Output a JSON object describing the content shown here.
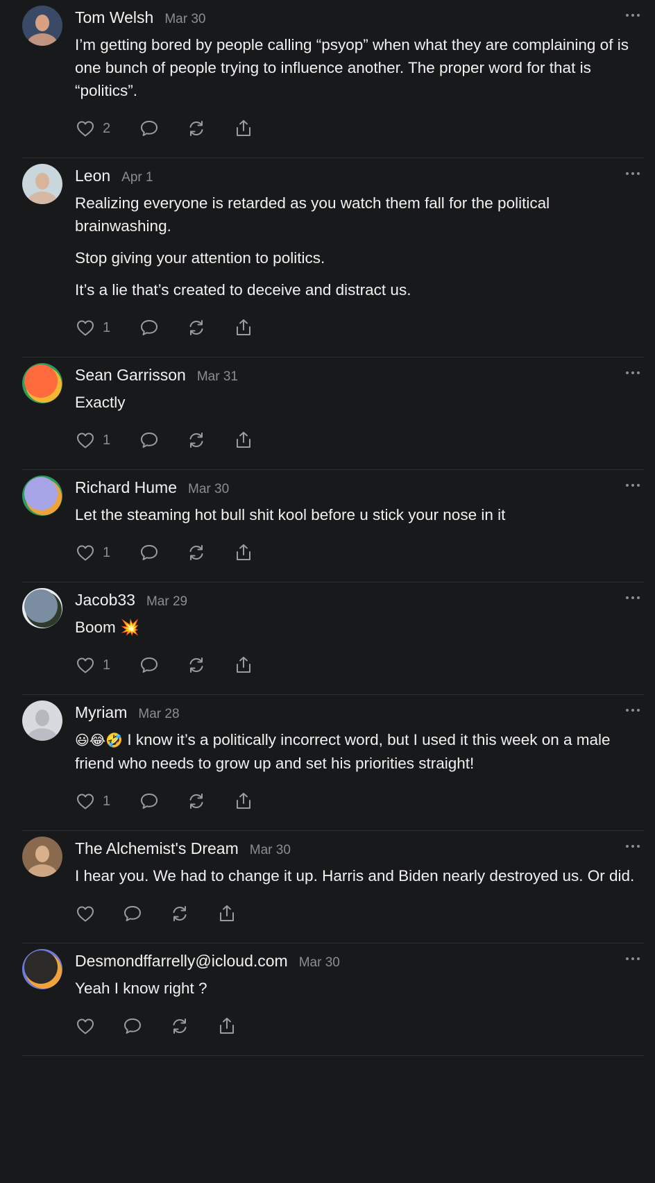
{
  "comments": [
    {
      "author": "Tom Welsh",
      "date": "Mar 30",
      "paragraphs": [
        "I’m getting bored by people calling “psyop” when what they are complaining of is one bunch of people trying to influence another. The proper word for that is “politics”."
      ],
      "likes": "2",
      "avatar_colors": [
        "#3a4a66",
        "#d9a184"
      ]
    },
    {
      "author": "Leon",
      "date": "Apr 1",
      "paragraphs": [
        "Realizing everyone is retarded as you watch them fall for the political brainwashing.",
        "Stop giving your attention to politics.",
        "It’s a lie that’s created to deceive and distract us."
      ],
      "likes": "1",
      "avatar_colors": [
        "#c9d6dc",
        "#d8b49a"
      ]
    },
    {
      "author": "Sean Garrisson",
      "date": "Mar 31",
      "paragraphs": [
        "Exactly"
      ],
      "likes": "1",
      "avatar_colors": [
        "#ff6b3d",
        "#f2b632",
        "#2f9a5d"
      ]
    },
    {
      "author": "Richard Hume",
      "date": "Mar 30",
      "paragraphs": [
        "Let the steaming hot bull shit kool before u stick your nose in it"
      ],
      "likes": "1",
      "avatar_colors": [
        "#a7a5e8",
        "#f0a23a",
        "#2f9a5d"
      ]
    },
    {
      "author": "Jacob33",
      "date": "Mar 29",
      "paragraphs": [
        "Boom 💥"
      ],
      "likes": "1",
      "avatar_colors": [
        "#7b8da0",
        "#2e3b2a",
        "#e8ecef"
      ]
    },
    {
      "author": "Myriam",
      "date": "Mar 28",
      "emojis": "😃😂🤣",
      "paragraphs": [
        " I know it’s a politically incorrect word, but I used it this week on a male friend who needs to grow up and set his priorities straight!"
      ],
      "likes": "1",
      "avatar_colors": [
        "#d7dadf",
        "#b5b9bf"
      ]
    },
    {
      "author": "The Alchemist's Dream",
      "date": "Mar 30",
      "paragraphs": [
        "I hear you. We had to change it up. Harris and Biden nearly destroyed us. Or did."
      ],
      "likes": "",
      "avatar_colors": [
        "#8a6a4f",
        "#d9b08c"
      ]
    },
    {
      "author": "Desmondffarrelly@icloud.com",
      "date": "Mar 30",
      "paragraphs": [
        "Yeah I know right ?"
      ],
      "likes": "",
      "avatar_colors": [
        "#2b2a28",
        "#f2a23a",
        "#6f7bd8"
      ]
    }
  ],
  "icons": {
    "like": "heart-icon",
    "reply": "speech-bubble-icon",
    "restack": "restack-icon",
    "share": "share-icon",
    "more": "more-dots-icon"
  }
}
